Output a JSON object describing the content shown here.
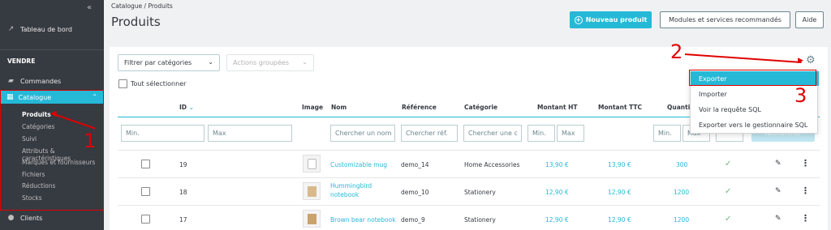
{
  "sidebar": {
    "collapse": "«",
    "dashboard": "Tableau de bord",
    "section": "VENDRE",
    "orders": "Commandes",
    "catalogue": "Catalogue",
    "sub_items": [
      "Produits",
      "Catégories",
      "Suivi",
      "Attributs & caractéristiques",
      "Marques et fournisseurs",
      "Fichiers",
      "Réductions",
      "Stocks"
    ],
    "clients": "Clients"
  },
  "header": {
    "breadcrumb": "Catalogue  /  Produits",
    "title": "Produits",
    "new_product": "Nouveau produit",
    "modules": "Modules et services recommandés",
    "help": "Aide"
  },
  "toolbar": {
    "filter_category": "Filtrer par catégories",
    "bulk_actions": "Actions groupées",
    "select_all": "Tout sélectionner"
  },
  "table": {
    "headers": {
      "id": "ID",
      "image": "Image",
      "name": "Nom",
      "reference": "Référence",
      "category": "Catégorie",
      "price_ht": "Montant HT",
      "price_ttc": "Montant TTC",
      "quantity": "Quanti"
    },
    "filters": {
      "id_min": "Min.",
      "id_max": "Max",
      "name": "Chercher un nom",
      "reference": "Chercher réf.",
      "category": "Chercher une c",
      "ht_min": "Min.",
      "ht_max": "Max",
      "qty_min": "Min.",
      "qty_max": "Max",
      "search": "Rechercher"
    },
    "rows": [
      {
        "id": "19",
        "name": "Customizable mug",
        "name2": "",
        "reference": "demo_14",
        "category": "Home Accessories",
        "price_ht": "13,90 €",
        "price_ttc": "13,90 €",
        "quantity": "300"
      },
      {
        "id": "18",
        "name": "Hummingbird",
        "name2": "notebook",
        "reference": "demo_10",
        "category": "Stationery",
        "price_ht": "12,90 €",
        "price_ttc": "12,90 €",
        "quantity": "1200"
      },
      {
        "id": "17",
        "name": "Brown bear notebook",
        "name2": "",
        "reference": "demo_9",
        "category": "Stationery",
        "price_ht": "12,90 €",
        "price_ttc": "12,90 €",
        "quantity": "1200"
      }
    ]
  },
  "export_menu": {
    "items": [
      "Exporter",
      "Importer",
      "Voir la requête SQL",
      "Exporter vers le gestionnaire SQL"
    ]
  },
  "annotations": {
    "n1": "1",
    "n2": "2",
    "n3": "3"
  },
  "colors": {
    "accent": "#25b9d7",
    "sidebar": "#363a41",
    "annotation": "#e00000",
    "success": "#70b580"
  }
}
